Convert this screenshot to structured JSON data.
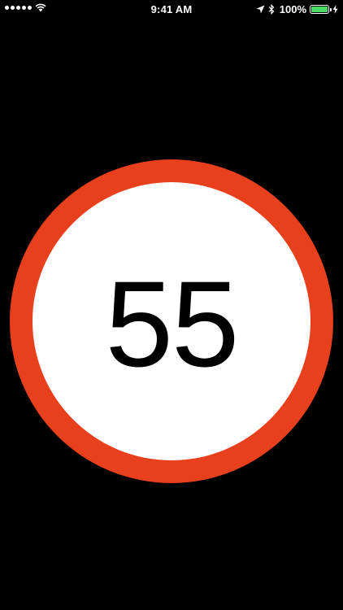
{
  "status_bar": {
    "time": "9:41 AM",
    "battery_percent": "100%",
    "battery_level": 1.0,
    "signal_bars": 5,
    "icons": [
      "signal-dots-icon",
      "wifi-icon",
      "location-arrow-icon",
      "bluetooth-icon",
      "battery-icon",
      "charging-bolt-icon"
    ]
  },
  "speed_sign": {
    "value": "55",
    "ring_color": "#e8401c",
    "face_color": "#ffffff",
    "text_color": "#000000"
  },
  "colors": {
    "background": "#000000",
    "battery_fill": "#4cd964"
  }
}
